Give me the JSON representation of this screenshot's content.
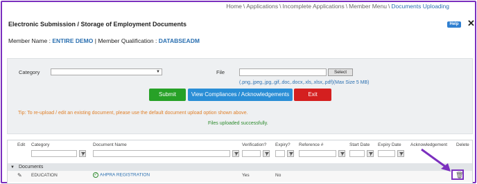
{
  "breadcrumb": {
    "items": [
      "Home",
      "Applications",
      "Incomplete Applications",
      "Member Menu"
    ],
    "current": "Documents Uploading",
    "separator": "\\"
  },
  "page": {
    "title": "Electronic Submission / Storage of Employment Documents",
    "help_label": "Help",
    "close_glyph": "✕"
  },
  "member": {
    "name_label": "Member Name :",
    "name_value": "ENTIRE DEMO",
    "divider": "|",
    "qual_label": "Member Qualification :",
    "qual_value": "DATABSEADM"
  },
  "form": {
    "category_label": "Category",
    "category_value": "",
    "file_label": "File",
    "file_value": "",
    "select_button": "Select",
    "file_hint": "(.png,.jpeg,.jpg,.gif,.doc,.docx,.xls,.xlsx,.pdf)(Max Size 5 MB)",
    "submit": "Submit",
    "view_compliances": "View Compliances / Acknowledgements",
    "exit": "Exit",
    "tip": "Tip: To re-upload / edit an existing document, please use the default document upload option shown above.",
    "success": "Files uploaded successfully."
  },
  "grid": {
    "columns": [
      "Edit",
      "Category",
      "Document Name",
      "Verification?",
      "Expiry?",
      "Reference #",
      "Start Date",
      "Expiry Date",
      "Acknowledgement",
      "Delete"
    ],
    "group_label": "Documents",
    "rows": [
      {
        "category": "EDUCATION",
        "document": "AHPRA REGISTRATION",
        "verification": "Yes",
        "expiry": "No"
      }
    ]
  },
  "colors": {
    "accent_border": "#7b2fbe",
    "submit": "#27a127",
    "view": "#2a8ed6",
    "exit": "#d41f1f",
    "link": "#2a6fb0"
  }
}
